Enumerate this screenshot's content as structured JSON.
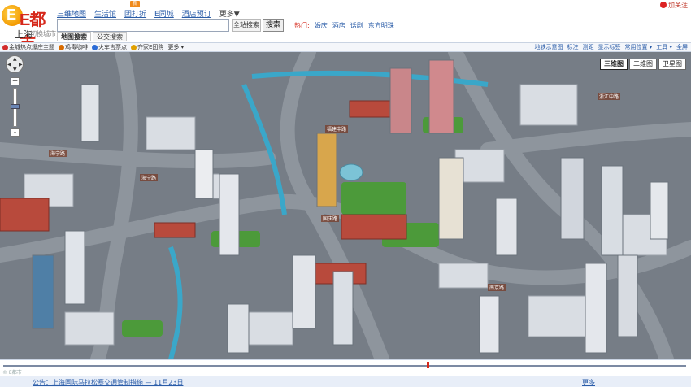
{
  "header": {
    "brand": "E都市",
    "city": "上海",
    "city_switch": "[切换城市]",
    "nav": [
      {
        "label": "三维地图"
      },
      {
        "label": "生活馆"
      },
      {
        "label": "团打折"
      },
      {
        "label": "E同城"
      },
      {
        "label": "酒店预订"
      }
    ],
    "nav_more": "更多▼",
    "new_badge": "新",
    "weibo": "加关注",
    "search": {
      "value": "",
      "scope_label": "全站搜索",
      "button_label": "搜索"
    },
    "hot_label": "热门:",
    "hot_items": [
      "婚庆",
      "酒店",
      "话剧",
      "东方明珠"
    ],
    "tabs": [
      {
        "label": "地图搜索"
      },
      {
        "label": "公交搜索"
      }
    ]
  },
  "toolbar": {
    "left": [
      {
        "label": "金城热点爆庄主题",
        "icon": "heart-icon",
        "color": "#d22b2b"
      },
      {
        "label": "鸡毒咖啡",
        "icon": "pin-icon",
        "color": "#d86b00"
      },
      {
        "label": "火车售票点",
        "icon": "train-icon",
        "color": "#2a6bd6"
      },
      {
        "label": "齐家E团购",
        "icon": "tag-icon",
        "color": "#e0a000"
      }
    ],
    "left_more": "更多 ▾",
    "right": [
      "地铁示意图",
      "标注",
      "测距",
      "显示标签",
      "常用位置 ▾",
      "工具 ▾",
      "全屏"
    ]
  },
  "map": {
    "types": [
      {
        "label": "三维图"
      },
      {
        "label": "二维图"
      },
      {
        "label": "卫星图"
      }
    ],
    "road_labels": [
      "海宁路",
      "国庆路",
      "南京路",
      "浙江中路",
      "海宁路",
      "福建中路"
    ],
    "zoom_in": "+",
    "zoom_out": "-"
  },
  "footer": {
    "copyright": "© E都市",
    "notice": "公告：上海国际马拉松赛交通管制措施 — 11月23日",
    "more": "更多"
  }
}
